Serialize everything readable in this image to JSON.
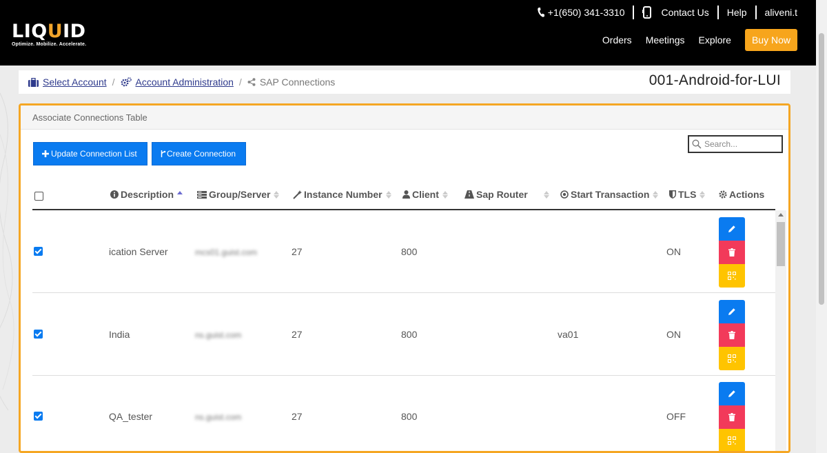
{
  "header": {
    "logo_text": "LIQUID",
    "logo_tagline": "Optimize. Mobilize. Accelerate.",
    "phone": "+1(650) 341-3310",
    "contact": "Contact Us",
    "help": "Help",
    "user": "aliveni.t",
    "nav": [
      "Orders",
      "Meetings",
      "Explore"
    ],
    "buy_now": "Buy Now",
    "accent_color": "#f7a51c"
  },
  "breadcrumb": {
    "items": [
      "Select Account",
      "Account Administration"
    ],
    "current": "SAP Connections",
    "account_name": "001-Android-for-LUI"
  },
  "panel": {
    "title": "Associate Connections Table",
    "update_button": "Update Connection List",
    "create_button": "Create Connection",
    "search_placeholder": "Search..."
  },
  "table": {
    "columns": [
      "Description",
      "Group/Server",
      "Instance Number",
      "Client",
      "Sap Router",
      "Start Transaction",
      "TLS",
      "Actions"
    ],
    "column_icons": [
      "info-icon",
      "server-icon",
      "wand-icon",
      "user-icon",
      "road-icon",
      "target-icon",
      "shield-icon",
      "gear-icon"
    ],
    "rows": [
      {
        "checked": true,
        "description": "ication Server",
        "server": "mcs01.guist.com",
        "instance": "27",
        "client": "800",
        "router": "",
        "transaction": "",
        "tls": "ON"
      },
      {
        "checked": true,
        "description": "India",
        "server": "ns.guist.com",
        "instance": "27",
        "client": "800",
        "router": "",
        "transaction": "va01",
        "tls": "ON"
      },
      {
        "checked": true,
        "description": "QA_tester",
        "server": "ns.guist.com",
        "instance": "27",
        "client": "800",
        "router": "",
        "transaction": "",
        "tls": "OFF"
      }
    ],
    "row_actions": [
      "edit-icon",
      "trash-icon",
      "qr-icon"
    ],
    "action_colors": {
      "edit": "#0a7bf0",
      "delete": "#f23a5a",
      "qr": "#ffc400"
    }
  }
}
